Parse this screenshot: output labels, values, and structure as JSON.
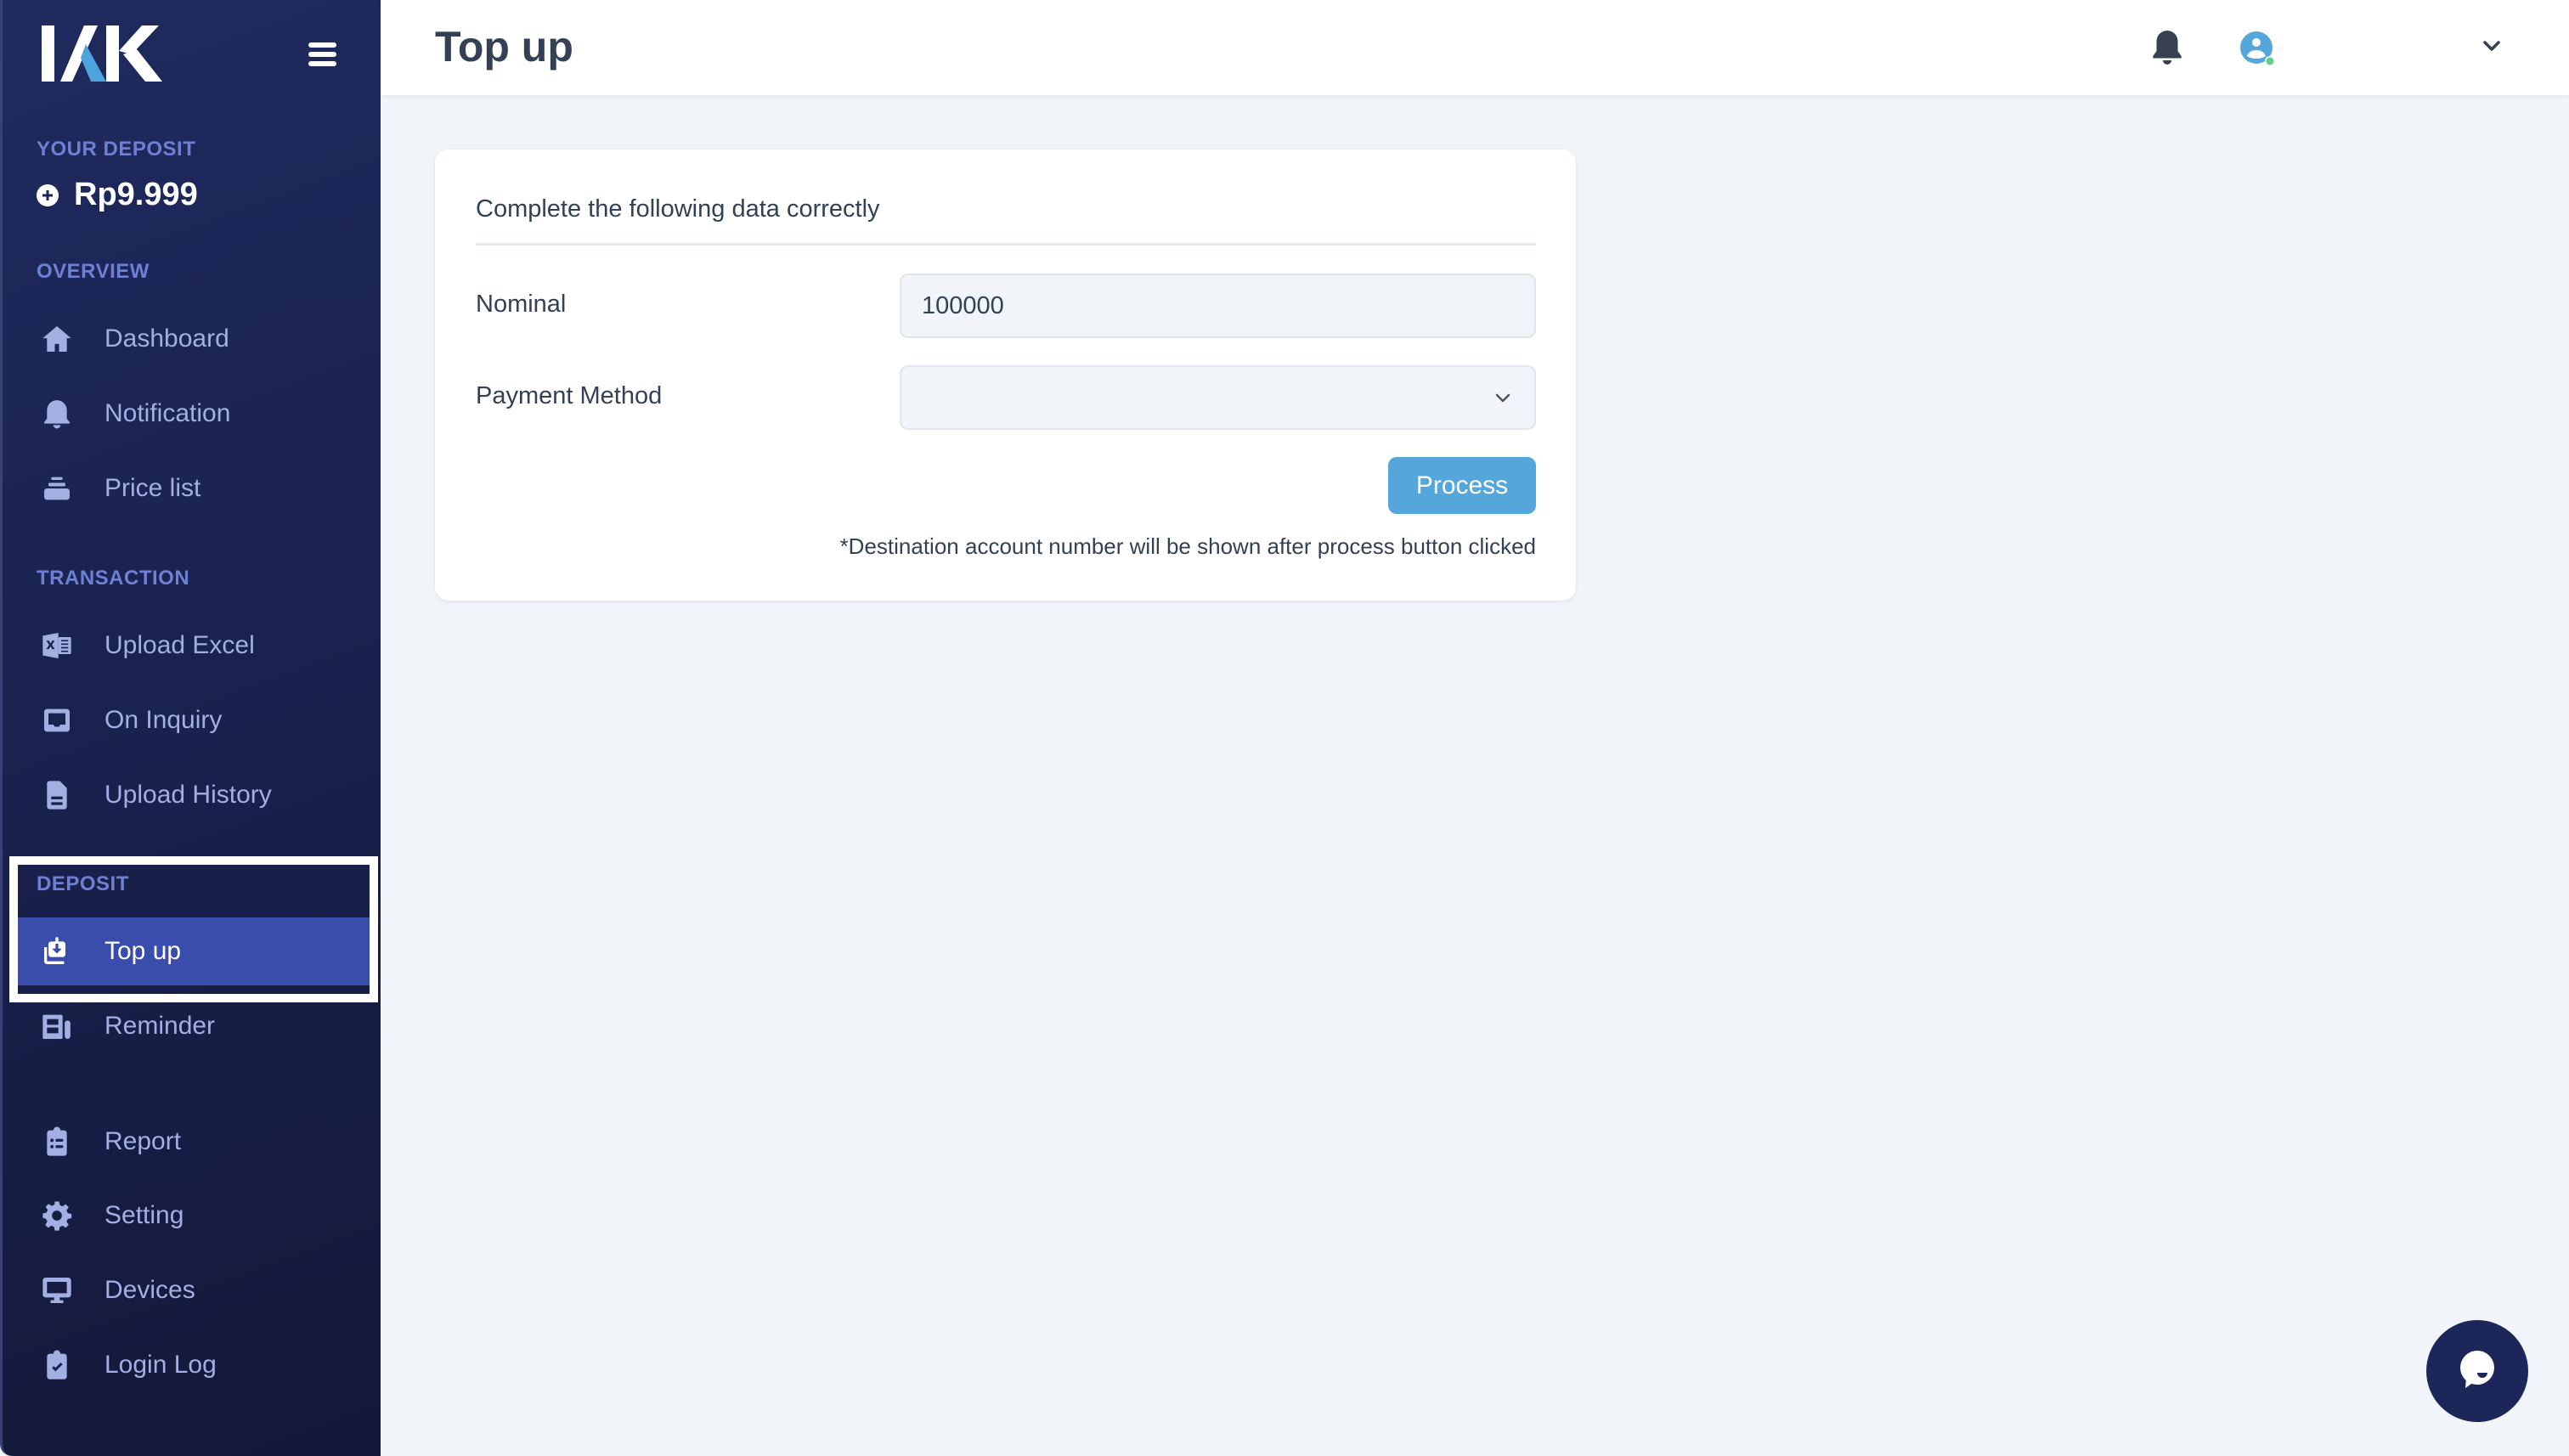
{
  "app": {
    "logo_text": "IAK",
    "brand_colors": {
      "sidebar": "#1d2556",
      "active": "#3a4cac",
      "accent": "#55a6db",
      "logo_accent": "#4fa3dc"
    }
  },
  "sidebar": {
    "deposit": {
      "label": "YOUR DEPOSIT",
      "amount": "Rp9.999"
    },
    "sections": {
      "overview": "OVERVIEW",
      "transaction": "TRANSACTION",
      "deposit": "DEPOSIT"
    },
    "items": [
      {
        "label": "Dashboard",
        "icon": "home-icon"
      },
      {
        "label": "Notification",
        "icon": "bell-icon"
      },
      {
        "label": "Price list",
        "icon": "stack-icon"
      },
      {
        "label": "Upload Excel",
        "icon": "excel-icon"
      },
      {
        "label": "On Inquiry",
        "icon": "inbox-icon"
      },
      {
        "label": "Upload History",
        "icon": "document-icon"
      },
      {
        "label": "Top up",
        "icon": "download-tray-icon",
        "active": true
      },
      {
        "label": "Reminder",
        "icon": "reminder-icon"
      },
      {
        "label": "Report",
        "icon": "clipboard-list-icon"
      },
      {
        "label": "Setting",
        "icon": "gear-icon"
      },
      {
        "label": "Devices",
        "icon": "monitor-icon"
      },
      {
        "label": "Login Log",
        "icon": "clipboard-check-icon"
      }
    ]
  },
  "header": {
    "title": "Top up"
  },
  "form": {
    "title": "Complete the following data correctly",
    "nominal": {
      "label": "Nominal",
      "value": "100000"
    },
    "payment_method": {
      "label": "Payment Method",
      "value": ""
    },
    "process_label": "Process",
    "note": "*Destination account number will be shown after process button clicked"
  }
}
